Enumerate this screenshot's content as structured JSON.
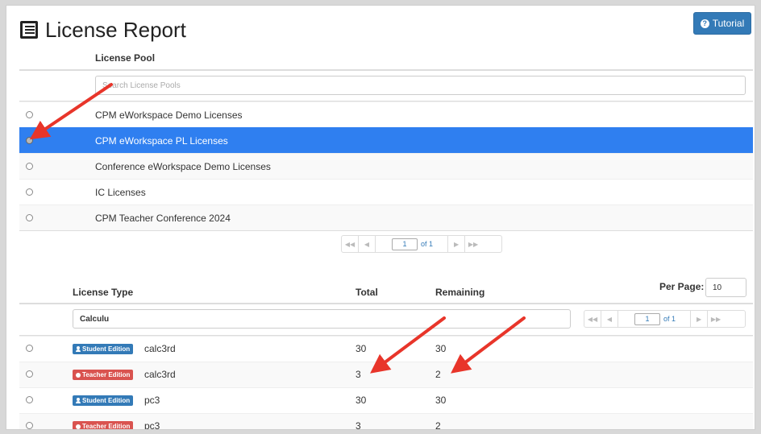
{
  "header": {
    "title": "License Report",
    "tutorial_label": "Tutorial"
  },
  "license_pool": {
    "column_header": "License Pool",
    "search_placeholder": "Search License Pools",
    "rows": [
      {
        "label": "CPM eWorkspace Demo Licenses",
        "selected": false
      },
      {
        "label": "CPM eWorkspace PL Licenses",
        "selected": true
      },
      {
        "label": "Conference eWorkspace Demo Licenses",
        "selected": false
      },
      {
        "label": "IC Licenses",
        "selected": false
      },
      {
        "label": "CPM Teacher Conference 2024",
        "selected": false
      }
    ],
    "pager": {
      "page": "1",
      "of_label": "of 1"
    }
  },
  "license_type": {
    "headers": {
      "type": "License Type",
      "total": "Total",
      "remaining": "Remaining"
    },
    "per_page_label": "Per Page:",
    "per_page_value": "10",
    "search_value": "Calculu",
    "pager": {
      "page": "1",
      "of_label": "of 1"
    },
    "rows": [
      {
        "badge": "Student Edition",
        "badge_kind": "student",
        "name": "calc3rd",
        "total": "30",
        "remaining": "30"
      },
      {
        "badge": "Teacher Edition",
        "badge_kind": "teacher",
        "name": "calc3rd",
        "total": "3",
        "remaining": "2"
      },
      {
        "badge": "Student Edition",
        "badge_kind": "student",
        "name": "pc3",
        "total": "30",
        "remaining": "30"
      },
      {
        "badge": "Teacher Edition",
        "badge_kind": "teacher",
        "name": "pc3",
        "total": "3",
        "remaining": "2"
      }
    ]
  },
  "colors": {
    "selected_row": "#2f7ff0",
    "student_badge": "#337ab7",
    "teacher_badge": "#d9534f",
    "annotation_arrow": "#e8352a"
  },
  "icons": {
    "title": "list-icon",
    "tutorial": "question-circle-icon",
    "student": "user-icon",
    "teacher": "apple-icon"
  }
}
